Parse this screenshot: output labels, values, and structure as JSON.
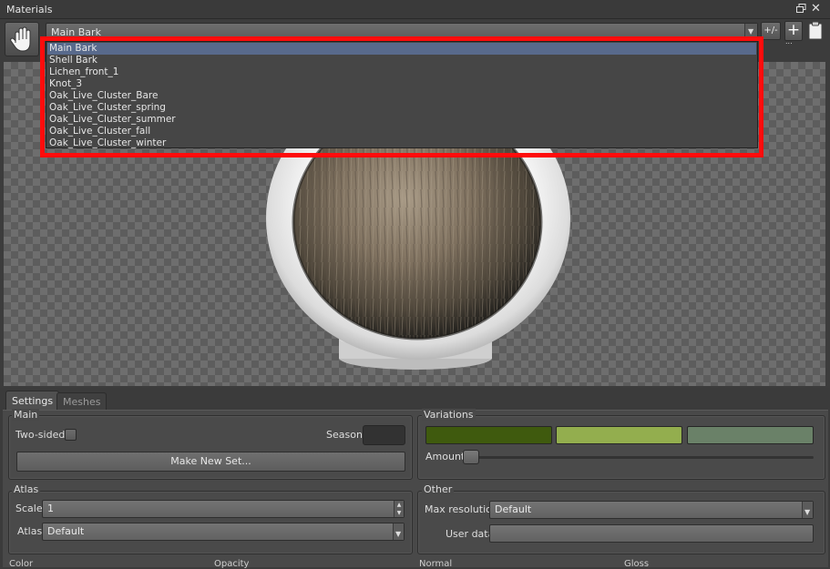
{
  "window": {
    "title": "Materials"
  },
  "toolbar": {
    "selected_material": "Main Bark",
    "plusminus_label": "+/-",
    "add_label": "+",
    "add_dots": "..."
  },
  "dropdown": {
    "items": [
      "Main Bark",
      "Shell Bark",
      "Lichen_front_1",
      "Knot_3",
      "Oak_Live_Cluster_Bare",
      "Oak_Live_Cluster_spring",
      "Oak_Live_Cluster_summer",
      "Oak_Live_Cluster_fall",
      "Oak_Live_Cluster_winter"
    ],
    "selected_index": 0
  },
  "tabs": {
    "settings": "Settings",
    "meshes": "Meshes"
  },
  "main_group": {
    "label": "Main",
    "two_sided_label": "Two-sided",
    "season_label": "Season",
    "season_color": "#323232",
    "make_new_set_label": "Make New Set..."
  },
  "variations_group": {
    "label": "Variations",
    "colors": [
      "#3f5a0e",
      "#93ae4e",
      "#6a8168"
    ],
    "amount_label": "Amount",
    "amount_value": 0
  },
  "atlas_group": {
    "label": "Atlas",
    "scale_label": "Scale",
    "scale_value": "1",
    "atlas_label": "Atlas",
    "atlas_value": "Default"
  },
  "other_group": {
    "label": "Other",
    "max_resolution_label": "Max resolution",
    "max_resolution_value": "Default",
    "user_data_label": "User data",
    "user_data_value": ""
  },
  "footer": {
    "columns": [
      "Color",
      "Opacity",
      "Normal",
      "Gloss"
    ]
  }
}
